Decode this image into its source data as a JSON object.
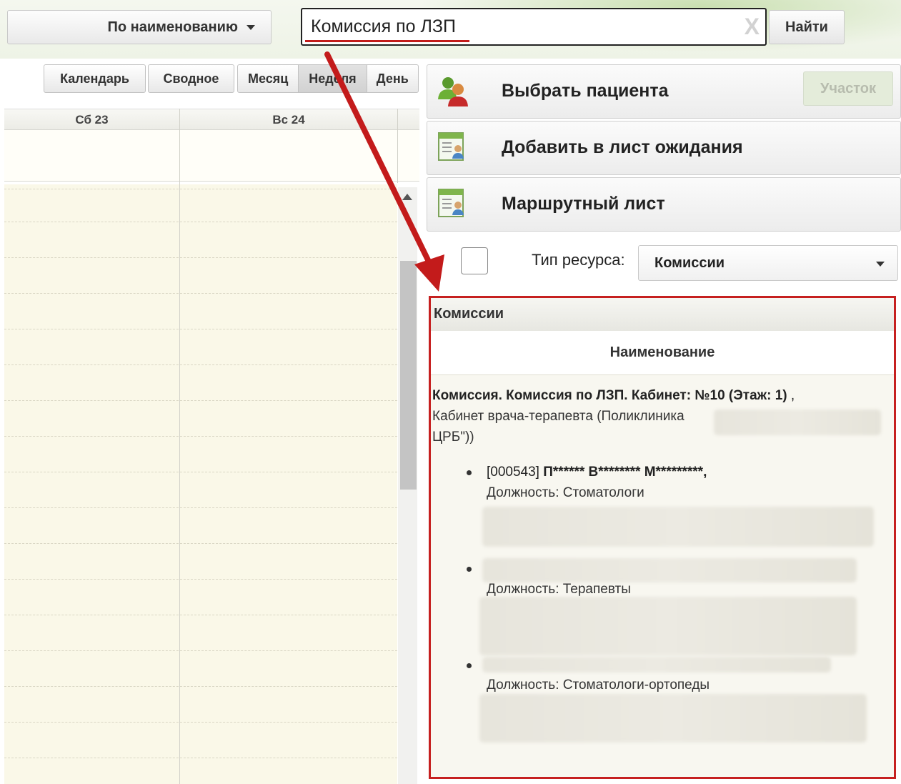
{
  "search": {
    "mode_label": "По наименованию",
    "query": "Комиссия по ЛЗП",
    "clear_glyph": "X",
    "find_label": "Найти"
  },
  "views": {
    "calendar": "Календарь",
    "summary": "Сводное",
    "month": "Месяц",
    "week": "Неделя",
    "day": "День",
    "active": "Неделя"
  },
  "calendar": {
    "columns": [
      "Сб 23",
      "Вс 24"
    ]
  },
  "actions": {
    "select_patient": "Выбрать пациента",
    "add_waitlist": "Добавить в лист ожидания",
    "route_sheet": "Маршрутный лист",
    "district": "Участок"
  },
  "resource": {
    "type_label": "Тип ресурса:",
    "type_value": "Комиссии"
  },
  "commissions": {
    "panel_title": "Комиссии",
    "column_header": "Наименование",
    "row_title": "Комиссия. Комиссия по ЛЗП. Кабинет: №10 (Этаж: 1)",
    "row_title_tail": " ,",
    "row_sub_line1": "Кабинет врача-терапевта (Поликлиника",
    "row_sub_line2": "ЦРБ\"))",
    "members": [
      {
        "code": "[000543] ",
        "name": "П****** В******** М*********,",
        "position": "Должность: Стоматологи"
      },
      {
        "code": "",
        "name": "",
        "position": "Должность: Терапевты"
      },
      {
        "code": "",
        "name": "",
        "position": "Должность: Стоматологи-ортопеды"
      }
    ]
  },
  "colors": {
    "highlight_border": "#c62020",
    "arrow": "#c31b1b",
    "calendar_body": "#faf8e8",
    "disabled_button": "#e4ecda"
  }
}
